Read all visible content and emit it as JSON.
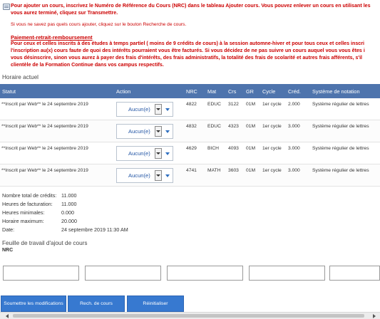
{
  "notice": {
    "line1": "Pour ajouter un cours, inscrivez le Numéro de Référence du Cours (NRC) dans le tableau Ajouter cours. Vous pouvez enlever un cours en utilisant les",
    "line2": "vous aurez terminé, cliquez sur Transmettre.",
    "line3": "Si vous ne savez pas quels cours ajouter, cliquez sur le bouton Recherche de cours."
  },
  "payment": {
    "link": "Paiement-retrait-remboursement",
    "line1": "Pour ceux et celles inscrits à des études à temps partiel ( moins de 9 crédits de cours) à la session automne-hiver et pour tous ceux et celles inscri",
    "line2": "l'inscription au(x) cours faute de quoi des intérêts pourraient vous être facturés. Si vous décidez de ne pas suivre un cours auquel vous vous êtes i",
    "line3": "vous désinscrire, sinon vous aurez à payer des frais d'intérêts, des frais administratifs, la totalité des frais de scolarité et autres frais afférents, s'il",
    "line4": "clientèle de la Formation Continue dans vos campus respectifs."
  },
  "schedule": {
    "title": "Horaire actuel",
    "headers": {
      "statut": "Statut",
      "action": "Action",
      "nrc": "NRC",
      "mat": "Mat",
      "crs": "Crs",
      "gr": "GR",
      "cycle": "Cycle",
      "cred": "Créd.",
      "systeme": "Système de notation"
    },
    "rows": [
      {
        "statut": "**Inscrit par Web** le 24 septembre 2019",
        "action": "Aucun(e)",
        "nrc": "4822",
        "mat": "EDUC",
        "crs": "3122",
        "gr": "01M",
        "cycle": "1er cycle",
        "cred": "2.000",
        "systeme": "Système régulier de lettres"
      },
      {
        "statut": "**Inscrit par Web** le 24 septembre 2019",
        "action": "Aucun(e)",
        "nrc": "4832",
        "mat": "EDUC",
        "crs": "4323",
        "gr": "01M",
        "cycle": "1er cycle",
        "cred": "3.000",
        "systeme": "Système régulier de lettres"
      },
      {
        "statut": "**Inscrit par Web** le 24 septembre 2019",
        "action": "Aucun(e)",
        "nrc": "4629",
        "mat": "BICH",
        "crs": "4093",
        "gr": "01M",
        "cycle": "1er cycle",
        "cred": "3.000",
        "systeme": "Système régulier de lettres"
      },
      {
        "statut": "**Inscrit par Web** le 24 septembre 2019",
        "action": "Aucun(e)",
        "nrc": "4741",
        "mat": "MATH",
        "crs": "3603",
        "gr": "01M",
        "cycle": "1er cycle",
        "cred": "3.000",
        "systeme": "Système régulier de lettres"
      }
    ]
  },
  "summary": {
    "credits_label": "Nombre total de crédits:",
    "credits_value": "11.000",
    "billing_label": "Heures de facturation:",
    "billing_value": "11.000",
    "min_label": "Heures minimales:",
    "min_value": "0.000",
    "max_label": "Horaire maximum:",
    "max_value": "20.000",
    "date_label": "Date:",
    "date_value": "24 septembre 2019 11:30 AM"
  },
  "worksheet": {
    "title": "Feuille de travail d'ajout de cours",
    "nrc_label": "NRC"
  },
  "buttons": {
    "submit": "Soumettre les modifications",
    "search": "Rech. de cours",
    "reset": "Réinitialiser"
  },
  "icons": {
    "info": "info-icon",
    "dropdown": "chevron-down-icon",
    "scroll_left": "arrow-left-icon",
    "scroll_right": "arrow-right-icon"
  },
  "colors": {
    "header_blue": "#4e74ad",
    "alert_red": "#cc0000",
    "button_blue": "#3779d0",
    "select_text": "#2356a5"
  }
}
